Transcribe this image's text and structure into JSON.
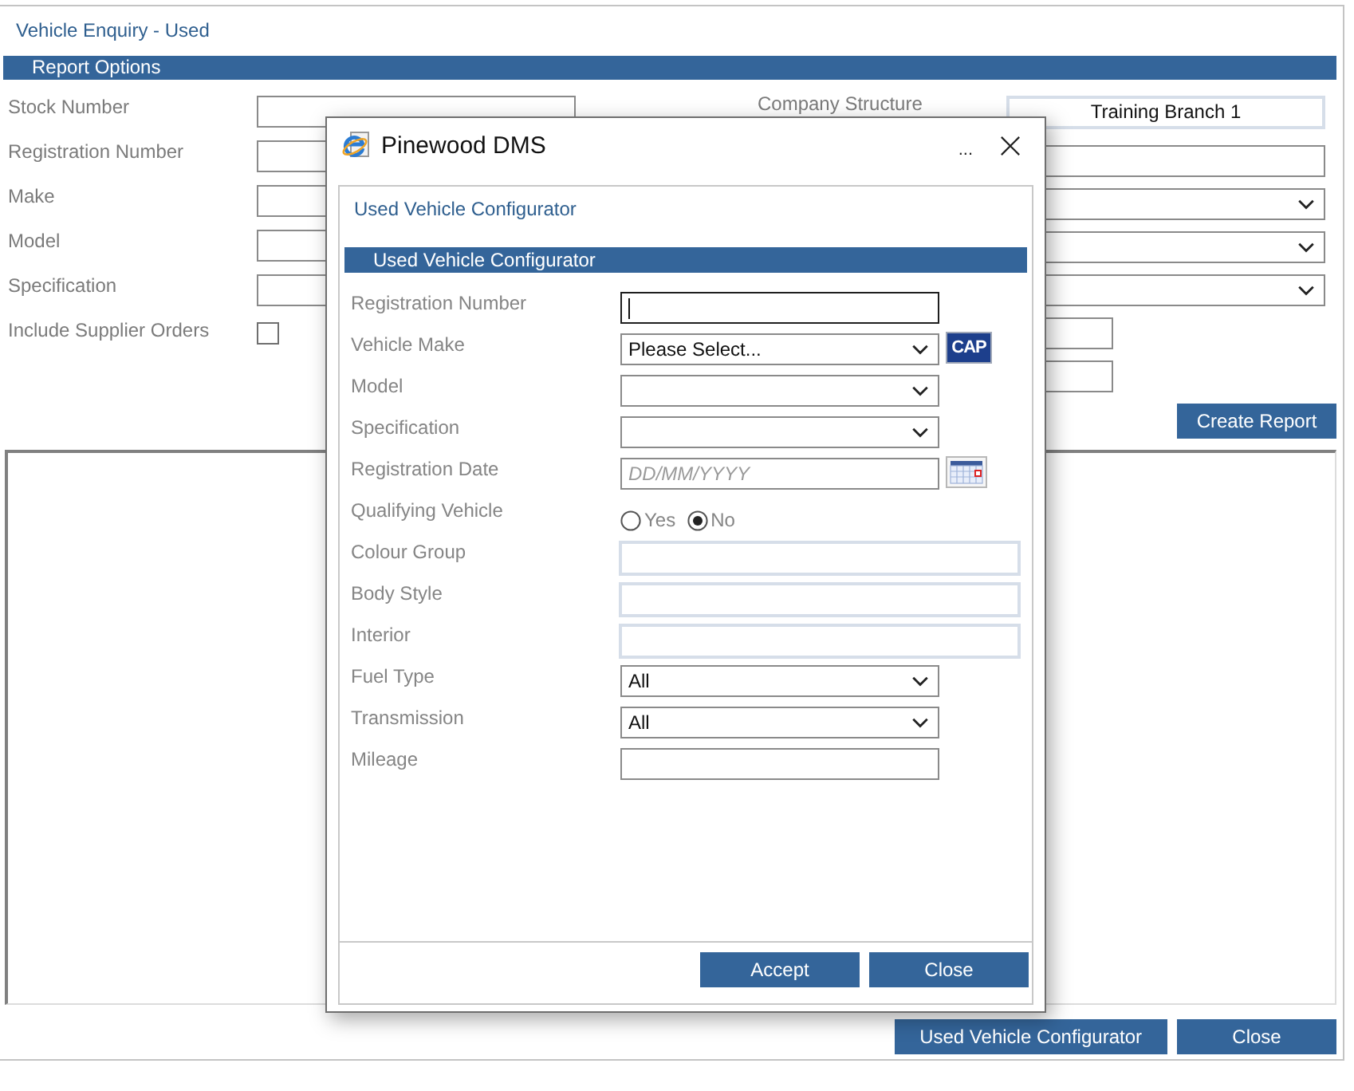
{
  "page": {
    "title": "Vehicle Enquiry - Used",
    "section": "Report Options"
  },
  "left_fields": [
    {
      "label": "Stock Number",
      "kind": "input"
    },
    {
      "label": "Registration Number",
      "kind": "input"
    },
    {
      "label": "Make",
      "kind": "input"
    },
    {
      "label": "Model",
      "kind": "input"
    },
    {
      "label": "Specification",
      "kind": "input"
    },
    {
      "label": "Include Supplier Orders",
      "kind": "checkbox",
      "checked": false
    }
  ],
  "right_fields": [
    {
      "label": "Company Structure",
      "kind": "readonly",
      "value": "Training Branch 1"
    },
    {
      "kind": "input"
    },
    {
      "kind": "select"
    },
    {
      "kind": "select"
    },
    {
      "kind": "select"
    },
    {
      "kind": "short"
    },
    {
      "kind": "short"
    }
  ],
  "create_button": "Create Report",
  "footer_buttons": [
    "Used Vehicle Configurator",
    "Close"
  ],
  "dialog": {
    "title": "Pinewood DMS",
    "more": "...",
    "heading": "Used Vehicle Configurator",
    "section": "Used Vehicle Configurator",
    "fields": [
      {
        "label": "Registration Number",
        "kind": "input",
        "focused": true
      },
      {
        "label": "Vehicle Make",
        "kind": "select",
        "value": "Please Select...",
        "lookup": "CAP",
        "focused": false
      },
      {
        "label": "Model",
        "kind": "select",
        "focused": false
      },
      {
        "label": "Specification",
        "kind": "select",
        "focused": false
      },
      {
        "label": "Registration Date",
        "kind": "date",
        "placeholder": "DD/MM/YYYY",
        "focused": false
      },
      {
        "label": "Qualifying Vehicle",
        "kind": "radio",
        "options": [
          {
            "label": "Yes",
            "selected": false
          },
          {
            "label": "No",
            "selected": true
          }
        ]
      },
      {
        "label": "Colour Group",
        "kind": "readonly",
        "focused": false
      },
      {
        "label": "Body Style",
        "kind": "readonly",
        "focused": false
      },
      {
        "label": "Interior",
        "kind": "readonly",
        "focused": false
      },
      {
        "label": "Fuel Type",
        "kind": "select",
        "value": "All",
        "focused": false
      },
      {
        "label": "Transmission",
        "kind": "select",
        "value": "All",
        "focused": false
      },
      {
        "label": "Mileage",
        "kind": "input",
        "focused": false
      }
    ],
    "buttons": [
      "Accept",
      "Close"
    ]
  }
}
